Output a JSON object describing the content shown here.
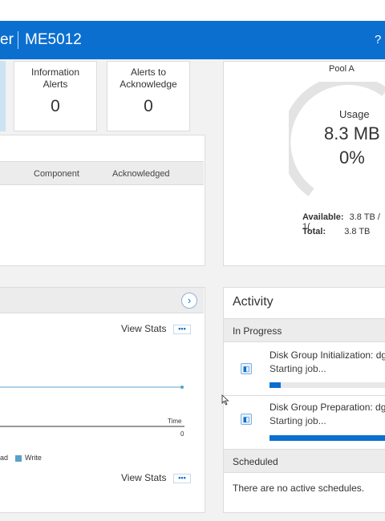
{
  "header": {
    "app_fragment": "er",
    "system_name": "ME5012",
    "help_icon": "?"
  },
  "alerts_summary": {
    "information": {
      "label_line1": "Information",
      "label_line2": "Alerts",
      "count": "0"
    },
    "acknowledge": {
      "label_line1": "Alerts to",
      "label_line2": "Acknowledge",
      "count": "0"
    }
  },
  "alerts_table": {
    "columns": [
      "Component",
      "Acknowledged"
    ]
  },
  "pool": {
    "name": "Pool A",
    "usage_label": "Usage",
    "usage_value": "8.3 MB",
    "usage_percent": "0%",
    "usage_fraction": 0.0,
    "available_label": "Available:",
    "available_value": "3.8 TB / 1(",
    "total_label": "Total:",
    "total_value": "3.8 TB"
  },
  "performance": {
    "next_icon": "›",
    "view_stats_label": "View Stats",
    "more_label": "•••",
    "x_axis_label": "Time",
    "x_axis_tick": "0",
    "legend": [
      {
        "name": "ad",
        "color": "#ffffff"
      },
      {
        "name": "Write",
        "color": "#5aa0c8"
      }
    ],
    "line_color": "#5aa0c8"
  },
  "activity": {
    "title": "Activity",
    "in_progress_label": "In Progress",
    "jobs": [
      {
        "name": "Disk Group Initialization: dg",
        "status": "Starting job...",
        "progress": 0.09,
        "icon": "job-icon"
      },
      {
        "name": "Disk Group Preparation: dg",
        "status": "Starting job...",
        "progress": 1.0,
        "icon": "job-icon"
      }
    ],
    "scheduled_label": "Scheduled",
    "no_schedules_text": "There are no active schedules."
  },
  "colors": {
    "brand_blue": "#0b6fd0",
    "panel_gray": "#ececec"
  }
}
